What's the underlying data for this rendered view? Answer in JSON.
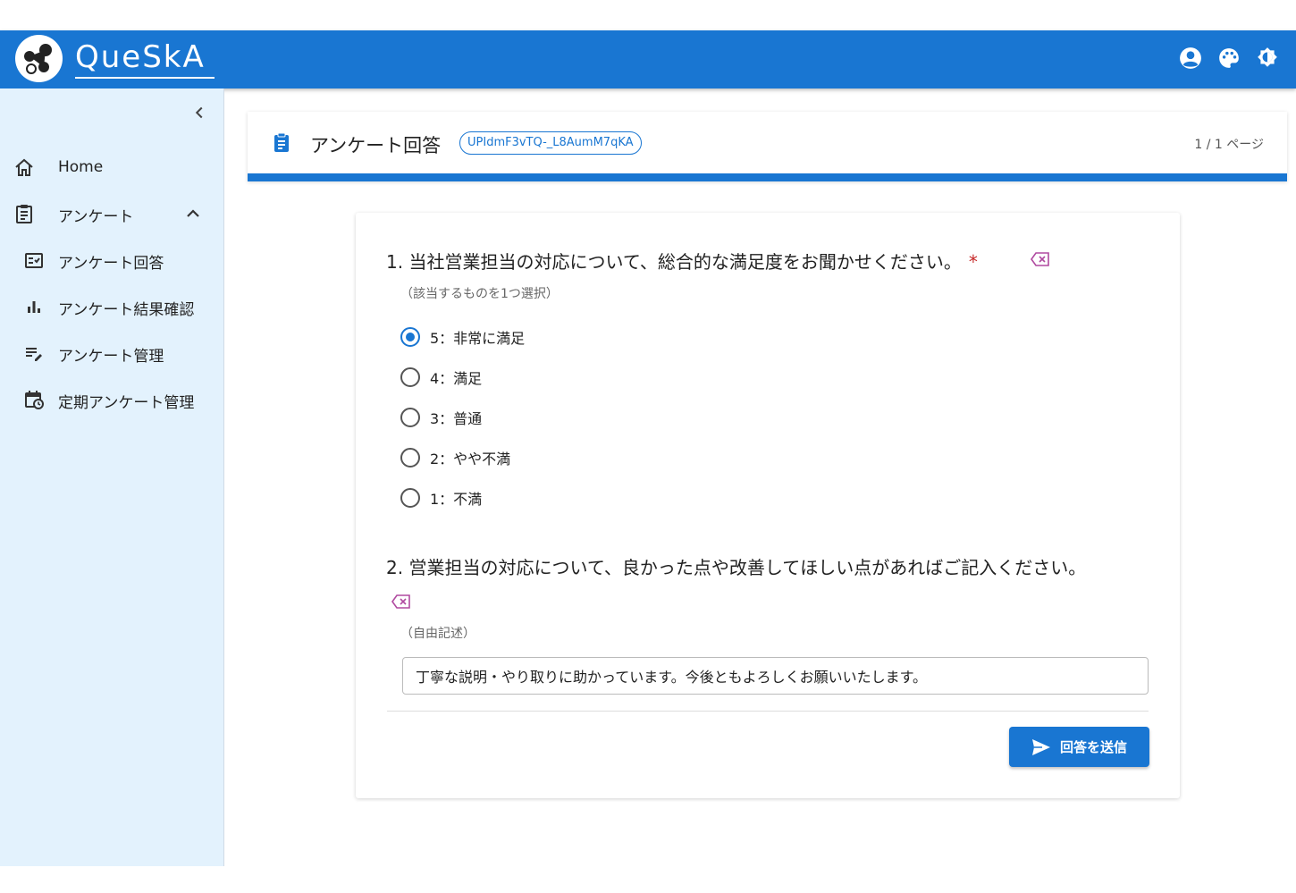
{
  "app": {
    "logo_text": "QueSkA",
    "icons": [
      "account-circle-icon",
      "palette-icon",
      "brightness-icon"
    ]
  },
  "sidebar": {
    "items": [
      {
        "label": "Home",
        "icon": "home-icon"
      },
      {
        "label": "アンケート",
        "icon": "clipboard-list-icon",
        "expanded": true
      },
      {
        "label": "アンケート回答",
        "icon": "checkbox-list-icon"
      },
      {
        "label": "アンケート結果確認",
        "icon": "bar-chart-icon"
      },
      {
        "label": "アンケート管理",
        "icon": "edit-list-icon"
      },
      {
        "label": "定期アンケート管理",
        "icon": "calendar-sync-icon"
      }
    ]
  },
  "header": {
    "title": "アンケート回答",
    "survey_id": "UPIdmF3vTQ-_L8AumM7qKA",
    "page_indicator": "1 / 1 ページ"
  },
  "form": {
    "q1": {
      "title": "1. 当社営業担当の対応について、総合的な満足度をお聞かせください。",
      "required_mark": "*",
      "hint": "（該当するものを1つ選択）",
      "options": [
        "5：非常に満足",
        "4：満足",
        "3：普通",
        "2：やや不満",
        "1：不満"
      ],
      "selected": "5：非常に満足"
    },
    "q2": {
      "title": "2. 営業担当の対応について、良かった点や改善してほしい点があればご記入ください。",
      "hint": "（自由記述）",
      "answer": "丁寧な説明・やり取りに助かっています。今後ともよろしくお願いいたします。"
    },
    "submit_label": "回答を送信"
  },
  "colors": {
    "primary": "#1976d2",
    "sidebar_bg": "#e3f2fd",
    "required": "#c62828",
    "clear_icon": "#b04aa0"
  }
}
